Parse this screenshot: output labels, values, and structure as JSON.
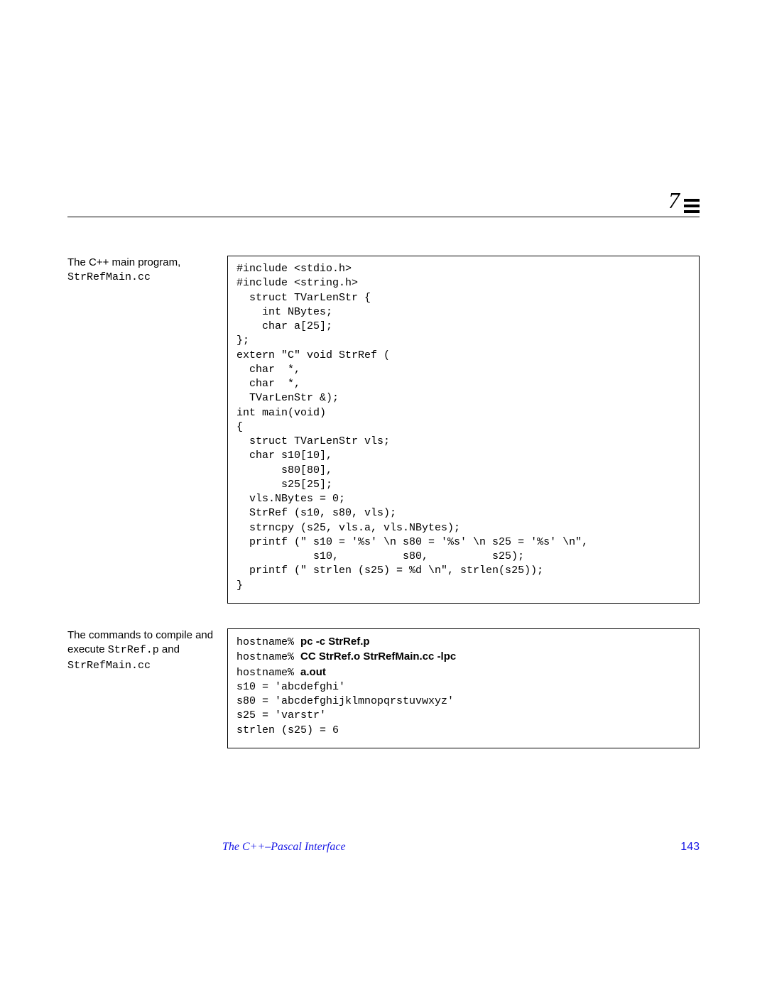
{
  "chapter": {
    "num": "7"
  },
  "block1": {
    "caption_text": "The C++ main program,",
    "caption_file": "StrRefMain.cc",
    "code": "#include <stdio.h>\n#include <string.h>\n  struct TVarLenStr {\n    int NBytes;\n    char a[25];\n};\nextern \"C\" void StrRef (\n  char  *,\n  char  *,\n  TVarLenStr &);\nint main(void)\n{\n  struct TVarLenStr vls;\n  char s10[10],\n       s80[80],\n       s25[25];\n  vls.NBytes = 0;\n  StrRef (s10, s80, vls);\n  strncpy (s25, vls.a, vls.NBytes);\n  printf (\" s10 = '%s' \\n s80 = '%s' \\n s25 = '%s' \\n\",\n            s10,          s80,          s25);\n  printf (\" strlen (s25) = %d \\n\", strlen(s25));\n}"
  },
  "block2": {
    "caption_text_a": "The commands to compile and execute ",
    "caption_file_a": "StrRef.p",
    "caption_text_b": " and ",
    "caption_file_b": "StrRefMain.cc",
    "prompt": "hostname%",
    "cmd1": "pc -c StrRef.p",
    "cmd2": "CC StrRef.o StrRefMain.cc -lpc",
    "cmd3": "a.out",
    "out": "s10 = 'abcdefghi'\ns80 = 'abcdefghijklmnopqrstuvwxyz'\ns25 = 'varstr'\nstrlen (s25) = 6"
  },
  "footer": {
    "title": "The C++–Pascal Interface",
    "page": "143"
  }
}
